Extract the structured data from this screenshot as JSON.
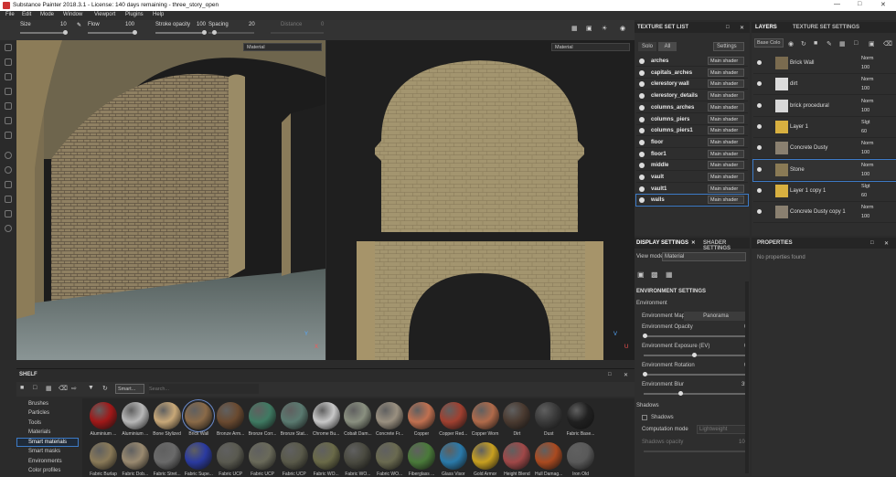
{
  "window": {
    "title": "Substance Painter 2018.3.1 - License: 140 days remaining - three_story_open"
  },
  "menu": [
    "File",
    "Edit",
    "Mode",
    "Window",
    "Viewport",
    "Plugins",
    "Help"
  ],
  "toolbar": {
    "size_label": "Size",
    "size_value": "10",
    "flow_label": "Flow",
    "flow_value": "100",
    "stroke_label": "Stroke opacity",
    "stroke_value": "100",
    "spacing_label": "Spacing",
    "spacing_value": "20",
    "distance_label": "Distance",
    "distance_value": "0"
  },
  "viewport": {
    "left_mode": "Material",
    "right_mode": "Material"
  },
  "texture_set_list": {
    "title": "TEXTURE SET LIST",
    "solo": "Solo",
    "all": "All",
    "settings": "Settings",
    "rows": [
      {
        "name": "arches",
        "shader": "Main shader"
      },
      {
        "name": "capitals_arches",
        "shader": "Main shader"
      },
      {
        "name": "clerestory wall",
        "shader": "Main shader"
      },
      {
        "name": "clerestory_details",
        "shader": "Main shader"
      },
      {
        "name": "columns_arches",
        "shader": "Main shader"
      },
      {
        "name": "columns_piers",
        "shader": "Main shader"
      },
      {
        "name": "columns_piers1",
        "shader": "Main shader"
      },
      {
        "name": "floor",
        "shader": "Main shader"
      },
      {
        "name": "floor1",
        "shader": "Main shader"
      },
      {
        "name": "middle",
        "shader": "Main shader"
      },
      {
        "name": "vault",
        "shader": "Main shader"
      },
      {
        "name": "vault1",
        "shader": "Main shader"
      },
      {
        "name": "walls",
        "shader": "Main shader"
      }
    ]
  },
  "layers": {
    "tab1": "LAYERS",
    "tab2": "TEXTURE SET SETTINGS",
    "channel": "Base Colo",
    "rows": [
      {
        "name": "Brick Wall",
        "blend": "Norm",
        "opacity": "100",
        "thumb": "#7a6b4f"
      },
      {
        "name": "dirt",
        "blend": "Norm",
        "opacity": "100",
        "thumb": "#dcdcdc"
      },
      {
        "name": "brick procedural",
        "blend": "Norm",
        "opacity": "100",
        "thumb": "#d8d8d8"
      },
      {
        "name": "Layer 1",
        "blend": "Slgt",
        "opacity": "60",
        "thumb": "#d8b040"
      },
      {
        "name": "Concrete Dusty",
        "blend": "Norm",
        "opacity": "100",
        "thumb": "#8a8070"
      },
      {
        "name": "Stone",
        "blend": "Norm",
        "opacity": "100",
        "thumb": "#8a7a55"
      },
      {
        "name": "Layer 1 copy 1",
        "blend": "Slgt",
        "opacity": "60",
        "thumb": "#d8b040"
      },
      {
        "name": "Concrete Dusty copy 1",
        "blend": "Norm",
        "opacity": "100",
        "thumb": "#8a8070"
      }
    ]
  },
  "display": {
    "tab1": "DISPLAY SETTINGS",
    "tab2": "SHADER SETTINGS",
    "viewmode_label": "View mode",
    "viewmode_value": "Material",
    "env_settings": "ENVIRONMENT SETTINGS",
    "environment": "Environment",
    "env_map_label": "Environment Map",
    "env_map_value": "Panorama",
    "opacity_label": "Environment Opacity",
    "opacity_value": "0",
    "exposure_label": "Environment Exposure (EV)",
    "exposure_value": "0",
    "rotation_label": "Environment Rotation",
    "rotation_value": "0",
    "blur_label": "Environment Blur",
    "blur_value": "35",
    "shadows_section": "Shadows",
    "shadows_label": "Shadows",
    "computation_label": "Computation mode",
    "computation_value": "Lightweight",
    "shadow_opacity_label": "Shadows opacity",
    "shadow_opacity_value": "100"
  },
  "properties": {
    "title": "PROPERTIES",
    "empty": "No properties found"
  },
  "shelf": {
    "title": "SHELF",
    "filter": "Smart...",
    "search_placeholder": "Search...",
    "categories": [
      "Brushes",
      "Particles",
      "Tools",
      "Materials",
      "Smart materials",
      "Smart masks",
      "Environments",
      "Color profiles"
    ],
    "selected_category": "Smart materials",
    "row1": [
      {
        "name": "Aluminium ...",
        "color": "#a01818"
      },
      {
        "name": "Aluminium ...",
        "color": "#b8b8b8"
      },
      {
        "name": "Bone Stylized",
        "color": "#c8a878"
      },
      {
        "name": "Brick Wall",
        "color": "#8a6a48"
      },
      {
        "name": "Bronze Arm...",
        "color": "#6a4a30"
      },
      {
        "name": "Bronze Corr...",
        "color": "#3f7a62"
      },
      {
        "name": "Bronze Stat...",
        "color": "#5a7a70"
      },
      {
        "name": "Chrome Bu...",
        "color": "#c8c8c8"
      },
      {
        "name": "Cobalt Dam...",
        "color": "#8a9080"
      },
      {
        "name": "Concrete Fr...",
        "color": "#9a9080"
      },
      {
        "name": "Copper",
        "color": "#c07050"
      },
      {
        "name": "Copper Red...",
        "color": "#a04030"
      },
      {
        "name": "Copper Worn",
        "color": "#b06a4a"
      },
      {
        "name": "Dirt",
        "color": "#4a3a30"
      },
      {
        "name": "Dust",
        "color": "#3a3a3a"
      },
      {
        "name": "Fabric Base...",
        "color": "#202020"
      }
    ],
    "row2": [
      {
        "name": "Fabric Burlap",
        "color": "#8a7a58"
      },
      {
        "name": "Fabric Dob...",
        "color": "#9a8a70"
      },
      {
        "name": "Fabric Stret...",
        "color": "#6a6a6a"
      },
      {
        "name": "Fabric Supe...",
        "color": "#2a3aa0"
      },
      {
        "name": "Fabric UCP",
        "color": "#5a5a50"
      },
      {
        "name": "Fabric UCP",
        "color": "#6a6a5a"
      },
      {
        "name": "Fabric UCP",
        "color": "#5a5a4a"
      },
      {
        "name": "Fabric WO...",
        "color": "#6a6a48"
      },
      {
        "name": "Fabric WO...",
        "color": "#4a4a40"
      },
      {
        "name": "Fabric WO...",
        "color": "#6a6a50"
      },
      {
        "name": "Fiberglass ...",
        "color": "#4a7a3a"
      },
      {
        "name": "Glass Visor",
        "color": "#2a7aaa"
      },
      {
        "name": "Gold Armor",
        "color": "#c8a020"
      },
      {
        "name": "Height Blend",
        "color": "#a04848"
      },
      {
        "name": "Hull Damag...",
        "color": "#aa4a20"
      },
      {
        "name": "Iron Old",
        "color": "#5a5a5a"
      }
    ]
  }
}
